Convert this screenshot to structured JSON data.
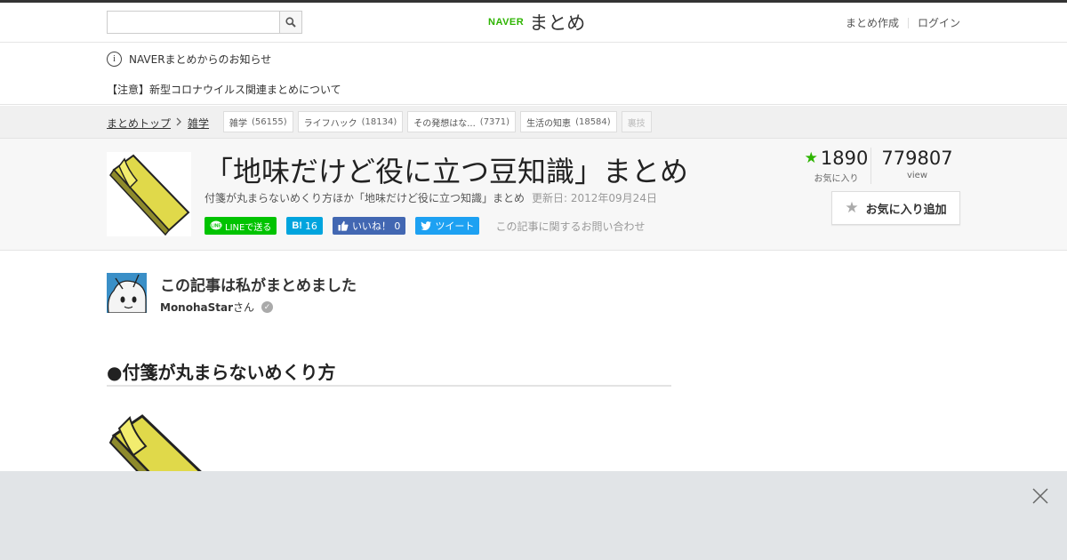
{
  "header": {
    "search": {
      "value": "",
      "placeholder": ""
    },
    "logo": {
      "brand": "NAVER",
      "name": "まとめ"
    },
    "links": {
      "create": "まとめ作成",
      "login": "ログイン"
    }
  },
  "notice": {
    "title": "NAVERまとめからのお知らせ",
    "link": "【注意】新型コロナウイルス関連まとめについて"
  },
  "breadcrumb": {
    "items": [
      "まとめトップ",
      "雑学"
    ],
    "tags": [
      {
        "label": "雑学",
        "count": "(56155)"
      },
      {
        "label": "ライフハック",
        "count": "(18134)"
      },
      {
        "label": "その発想はな...",
        "count": "(7371)"
      },
      {
        "label": "生活の知恵",
        "count": "(18584)"
      },
      {
        "label": "裏技",
        "count": ""
      }
    ]
  },
  "article": {
    "title": "「地味だけど役に立つ豆知識」まとめ",
    "description": "付箋が丸まらないめくり方ほか「地味だけど役に立つ知識」まとめ",
    "updated": "更新日: 2012年09月24日",
    "share": {
      "line": "LINEで送る",
      "hatena_count": "16",
      "facebook": "いいね！ 0",
      "twitter": "ツイート"
    },
    "contact": "この記事に関するお問い合わせ",
    "stats": {
      "favorites": "1890",
      "favorites_label": "お気に入り",
      "views": "779807",
      "views_label": "view"
    },
    "favorite_button": "お気に入り追加"
  },
  "author": {
    "heading": "この記事は私がまとめました",
    "name": "MonohaStar",
    "suffix": "さん"
  },
  "section": {
    "heading": "●付箋が丸まらないめくり方"
  },
  "colors": {
    "accent_green": "#2db400",
    "line": "#00c300",
    "hatena": "#00a4de",
    "facebook": "#4267b2",
    "twitter": "#1da1f2",
    "sticky_note": "#e0d94a",
    "overlay": "#e1e4e7"
  },
  "icons": [
    "search-icon",
    "info-icon",
    "chevron-right-icon",
    "star-icon",
    "line-icon",
    "hatena-icon",
    "thumbs-up-icon",
    "twitter-bird-icon",
    "verified-check-icon",
    "close-icon"
  ]
}
